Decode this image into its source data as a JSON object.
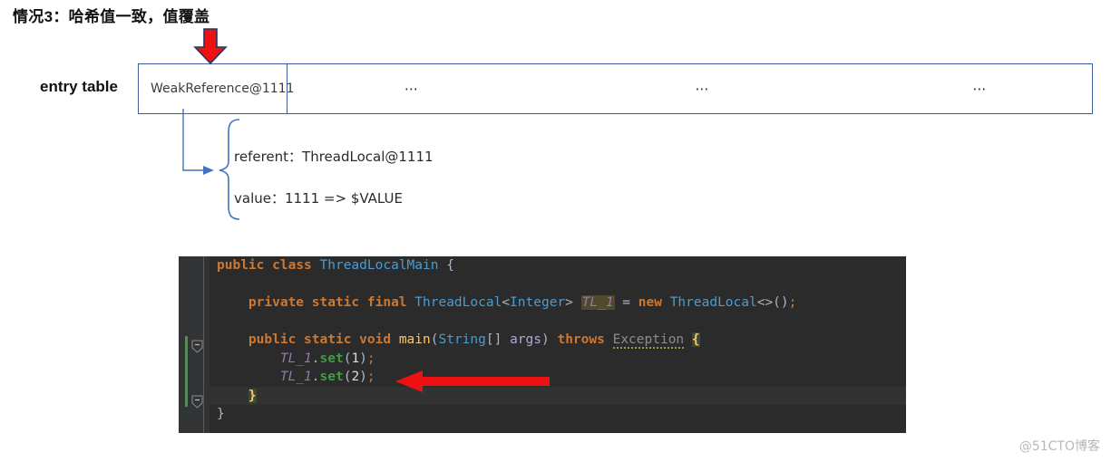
{
  "heading": "情况3：哈希值一致，值覆盖",
  "diagram": {
    "entry_table_label": "entry table",
    "table_cells": [
      "WeakReference@1111",
      "⋯",
      "⋯",
      "⋯"
    ],
    "annotation": {
      "referent": "referent：ThreadLocal@1111",
      "value": "value：1111  => $VALUE"
    },
    "down_arrow_name": "red-down-arrow",
    "brace_name": "curly-brace"
  },
  "code": {
    "language": "java",
    "lines": [
      {
        "n": 1,
        "tokens": [
          {
            "t": "public",
            "c": "kw"
          },
          {
            "t": " ",
            "c": "punct"
          },
          {
            "t": "class",
            "c": "kw"
          },
          {
            "t": " ",
            "c": "punct"
          },
          {
            "t": "ThreadLocalMain",
            "c": "type"
          },
          {
            "t": " {",
            "c": "punct"
          }
        ]
      },
      {
        "n": 2,
        "tokens": []
      },
      {
        "n": 3,
        "tokens": [
          {
            "t": "    private",
            "c": "kw"
          },
          {
            "t": " ",
            "c": "punct"
          },
          {
            "t": "static",
            "c": "kw"
          },
          {
            "t": " ",
            "c": "punct"
          },
          {
            "t": "final",
            "c": "kw"
          },
          {
            "t": " ",
            "c": "punct"
          },
          {
            "t": "ThreadLocal",
            "c": "type"
          },
          {
            "t": "<",
            "c": "punct"
          },
          {
            "t": "Integer",
            "c": "type"
          },
          {
            "t": "> ",
            "c": "punct"
          },
          {
            "t": "TL_1",
            "c": "field-hl"
          },
          {
            "t": " = ",
            "c": "punct"
          },
          {
            "t": "new",
            "c": "kw"
          },
          {
            "t": " ",
            "c": "punct"
          },
          {
            "t": "ThreadLocal",
            "c": "type"
          },
          {
            "t": "<>()",
            "c": "punct"
          },
          {
            "t": ";",
            "c": "semi"
          }
        ]
      },
      {
        "n": 4,
        "tokens": []
      },
      {
        "n": 5,
        "tokens": [
          {
            "t": "    public",
            "c": "kw"
          },
          {
            "t": " ",
            "c": "punct"
          },
          {
            "t": "static",
            "c": "kw"
          },
          {
            "t": " ",
            "c": "punct"
          },
          {
            "t": "void",
            "c": "kw"
          },
          {
            "t": " ",
            "c": "punct"
          },
          {
            "t": "main",
            "c": "fn"
          },
          {
            "t": "(",
            "c": "punct"
          },
          {
            "t": "String",
            "c": "type"
          },
          {
            "t": "[] ",
            "c": "punct"
          },
          {
            "t": "args",
            "c": "param"
          },
          {
            "t": ") ",
            "c": "punct"
          },
          {
            "t": "throws",
            "c": "kw"
          },
          {
            "t": " ",
            "c": "punct"
          },
          {
            "t": "Exception",
            "c": "warn"
          },
          {
            "t": " ",
            "c": "punct"
          },
          {
            "t": "{",
            "c": "brace-hl"
          }
        ]
      },
      {
        "n": 6,
        "tokens": [
          {
            "t": "        ",
            "c": "punct"
          },
          {
            "t": "TL_1",
            "c": "field"
          },
          {
            "t": ".",
            "c": "punct"
          },
          {
            "t": "set",
            "c": "meth"
          },
          {
            "t": "(",
            "c": "punct"
          },
          {
            "t": "1",
            "c": "num"
          },
          {
            "t": ")",
            "c": "punct"
          },
          {
            "t": ";",
            "c": "semi"
          }
        ]
      },
      {
        "n": 7,
        "tokens": [
          {
            "t": "        ",
            "c": "punct"
          },
          {
            "t": "TL_1",
            "c": "field"
          },
          {
            "t": ".",
            "c": "punct"
          },
          {
            "t": "set",
            "c": "meth"
          },
          {
            "t": "(",
            "c": "punct"
          },
          {
            "t": "2",
            "c": "num"
          },
          {
            "t": ")",
            "c": "punct"
          },
          {
            "t": ";",
            "c": "semi"
          }
        ]
      },
      {
        "n": 8,
        "selected": true,
        "tokens": [
          {
            "t": "    ",
            "c": "punct"
          },
          {
            "t": "}",
            "c": "brace-hl"
          }
        ]
      },
      {
        "n": 9,
        "tokens": [
          {
            "t": "}",
            "c": "punct"
          }
        ]
      }
    ]
  },
  "watermark": "@51CTO博客",
  "colors": {
    "table_border": "#3b5e9c",
    "arrow_red": "#ee1111",
    "arrow_outline": "#1f3864",
    "code_bg": "#2b2b2b",
    "gutter_bg": "#313335",
    "keyword": "#cc7832",
    "type": "#499cd5",
    "method_decl": "#ffc66d",
    "field": "#9876aa",
    "method_call": "#3f9c3f",
    "brace_highlight": "#3b4a32",
    "field_highlight": "#4f4b2a"
  }
}
